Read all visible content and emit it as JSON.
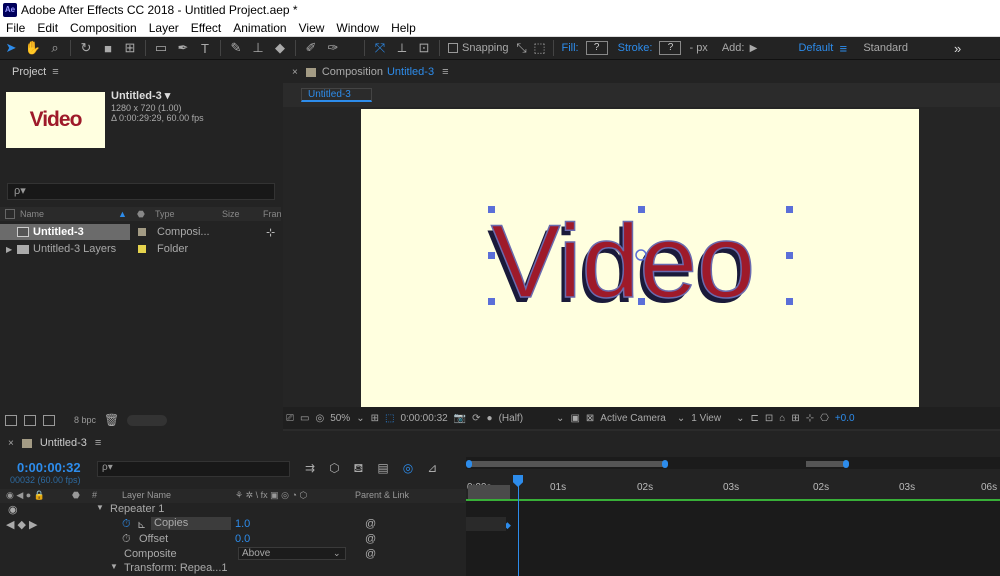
{
  "app": {
    "title": "Adobe After Effects CC 2018 - Untitled Project.aep *",
    "icon_label": "Ae"
  },
  "menu": [
    "File",
    "Edit",
    "Composition",
    "Layer",
    "Effect",
    "Animation",
    "View",
    "Window",
    "Help"
  ],
  "toolbar": {
    "snapping_label": "Snapping",
    "fill_label": "Fill:",
    "fill_value": "?",
    "stroke_label": "Stroke:",
    "stroke_value": "?",
    "stroke_unit": "- px",
    "add_label": "Add:",
    "workspace_default": "Default",
    "workspace_standard": "Standard",
    "overflow": "»"
  },
  "project": {
    "panel_title": "Project",
    "thumb_text": "Video",
    "comp_name": "Untitled-3 ▾",
    "comp_size": "1280 x 720 (1.00)",
    "comp_duration": "Δ 0:00:29:29, 60.00 fps",
    "search_placeholder": "ρ▾",
    "columns": {
      "name": "Name",
      "type": "Type",
      "size": "Size",
      "frame": "Fran"
    },
    "items": [
      {
        "name": "Untitled-3",
        "type": "Composi...",
        "swatch": "#a39b84",
        "selected": true
      },
      {
        "name": "Untitled-3 Layers",
        "type": "Folder",
        "swatch": "#e5d34d",
        "selected": false
      }
    ],
    "bpc": "8 bpc"
  },
  "composition": {
    "panel_label": "Composition",
    "comp_name": "Untitled-3",
    "tab": "Untitled-3",
    "canvas_text": "Video",
    "canvas_bg": "#ffffdf",
    "text_color": "#9e1a2a",
    "zoom": "50%",
    "timecode": "0:00:00:32",
    "resolution": "(Half)",
    "camera": "Active Camera",
    "views": "1 View",
    "exposure": "+0.0"
  },
  "timeline": {
    "tab": "Untitled-3",
    "timecode": "0:00:00:32",
    "frames": "00032 (60.00 fps)",
    "search_placeholder": "ρ▾",
    "col_layer_name": "Layer Name",
    "col_parent": "Parent & Link",
    "col_num": "#",
    "rows": [
      {
        "label": "Repeater 1",
        "value": ""
      },
      {
        "label": "Copies",
        "value": "1.0"
      },
      {
        "label": "Offset",
        "value": "0.0"
      },
      {
        "label": "Composite",
        "value": "Above"
      },
      {
        "label": "Transform: Repea...1",
        "value": ""
      }
    ],
    "ruler_ticks": [
      "0:00s",
      "01s",
      "02s",
      "03s",
      "02s",
      "03s",
      "06s"
    ]
  }
}
